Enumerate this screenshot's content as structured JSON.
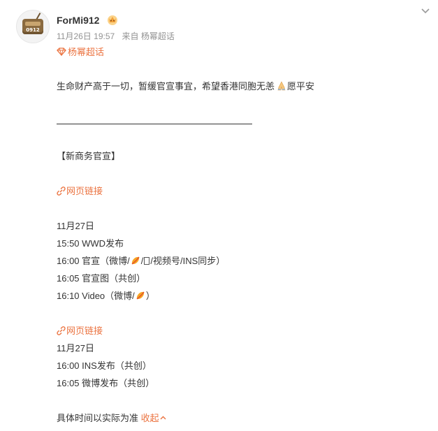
{
  "post": {
    "username": "ForMi912",
    "avatar_text": "0912",
    "date": "11月26日 19:57",
    "source": "来自 杨幂超话",
    "topic": "杨幂超话"
  },
  "content": {
    "intro_before": "生命财产高于一切，暂缓官宣事宜，希望香港同胞无恙",
    "intro_after": "愿平安",
    "section_title": "【新商务官宣】",
    "link1": "网页链接",
    "date1": "11月27日",
    "l1": "15:50 WWD发布",
    "l2_a": "16:00 官宣（微博/",
    "l2_b": "/",
    "l2_c": "/视频号/INS同步）",
    "l3": "16:05 官宣图（共创）",
    "l4_a": "16:10 Video（微博/",
    "l4_b": "）",
    "link2": "网页链接",
    "date2": "11月27日",
    "l5": "16:00 INS发布（共创）",
    "l6": "16:05 微博发布（共创）",
    "footer_text": "具体时间以实际为准",
    "collapse": "收起"
  },
  "icons": {
    "vip": "crown-badge-icon",
    "topic": "topic-diamond-icon",
    "link": "link-icon",
    "more": "chevron-down-icon",
    "mango": "mango-icon",
    "pray": "praying-hands-icon"
  },
  "colors": {
    "accent": "#eb7340",
    "meta": "#939393",
    "text": "#333333"
  }
}
